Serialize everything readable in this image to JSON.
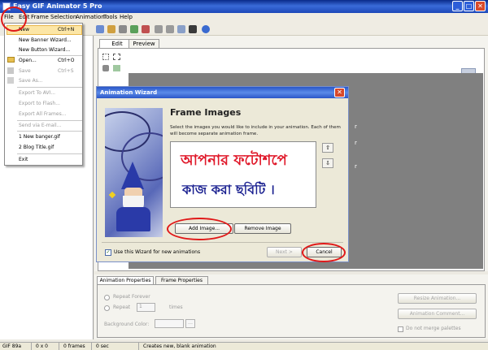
{
  "window": {
    "title": "Easy GIF Animator 5 Pro",
    "minimize": "_",
    "maximize": "□",
    "close": "✕"
  },
  "menubar": [
    "File",
    "Edit",
    "Frame",
    "Selection",
    "Animation",
    "Tools",
    "Help"
  ],
  "file_menu": {
    "items": [
      {
        "label": "New",
        "shortcut": "Ctrl+N"
      },
      {
        "label": "New Banner Wizard..."
      },
      {
        "label": "New Button Wizard..."
      },
      {
        "label": "Open...",
        "shortcut": "Ctrl+O"
      },
      {
        "label": "Save",
        "shortcut": "Ctrl+S"
      },
      {
        "label": "Save As..."
      },
      {
        "label": "Export To AVI..."
      },
      {
        "label": "Export to Flash..."
      },
      {
        "label": "Export All Frames..."
      },
      {
        "label": "Send via E-mail..."
      },
      {
        "label": "1 New banger.gif"
      },
      {
        "label": "2 Blog Title.gif"
      },
      {
        "label": "Exit"
      }
    ]
  },
  "editor_tabs": [
    "Edit",
    "Preview"
  ],
  "canvas_side_letters": [
    "r",
    "r",
    "r"
  ],
  "wizard": {
    "title": "Animation Wizard",
    "heading": "Frame Images",
    "description": "Select the images you would like to include in your animation. Each of them will become separate animation frame.",
    "image_text_line1": "আপনার ফটোশপে",
    "image_text_line2": "কাজ করা ছবিটি ।",
    "move_up": "⇧",
    "move_down": "⇩",
    "add_image": "Add Image...",
    "remove_image": "Remove Image",
    "checkbox_label": "Use this Wizard for new animations",
    "checkbox_mark": "✓",
    "next": "Next >",
    "cancel": "Cancel"
  },
  "properties": {
    "tabs": [
      "Animation Properties",
      "Frame Properties"
    ],
    "repeat_forever": "Repeat Forever",
    "repeat": "Repeat",
    "repeat_count": "1",
    "times": "times",
    "background_color": "Background Color:",
    "resize": "Resize Animation...",
    "comment": "Animation Comment...",
    "no_merge": "Do not merge palettes"
  },
  "status": [
    "GIF 89a",
    "0 x 0",
    "0 frames",
    "0 sec",
    "Creates new, blank animation"
  ],
  "colors": {
    "titlebar": "#1c47b8",
    "annotation": "#e01818",
    "canvas": "#808080",
    "bengali_red": "#e0192a",
    "bengali_blue": "#1a2090"
  }
}
